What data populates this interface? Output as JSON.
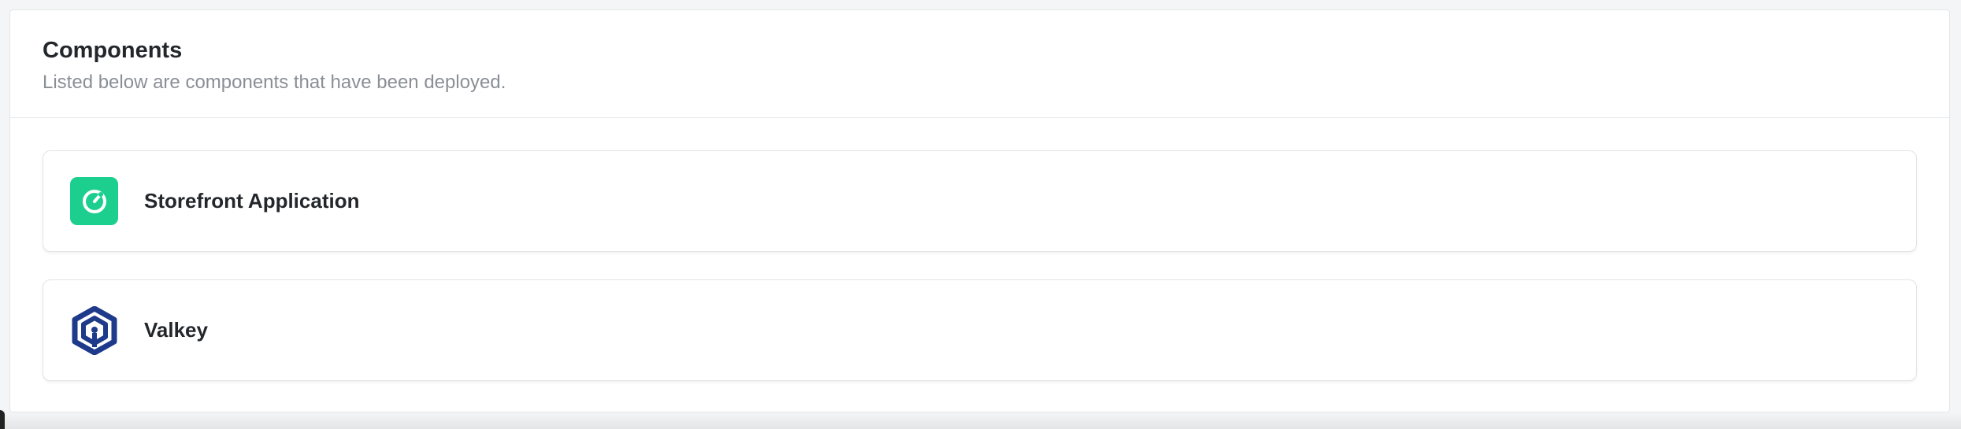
{
  "panel": {
    "title": "Components",
    "subtitle": "Listed below are components that have been deployed."
  },
  "components": [
    {
      "name": "Storefront Application",
      "icon": "storefront-app-icon",
      "color": "#1ccf8f"
    },
    {
      "name": "Valkey",
      "icon": "valkey-logo-icon",
      "color": "#1e3a8a"
    }
  ]
}
